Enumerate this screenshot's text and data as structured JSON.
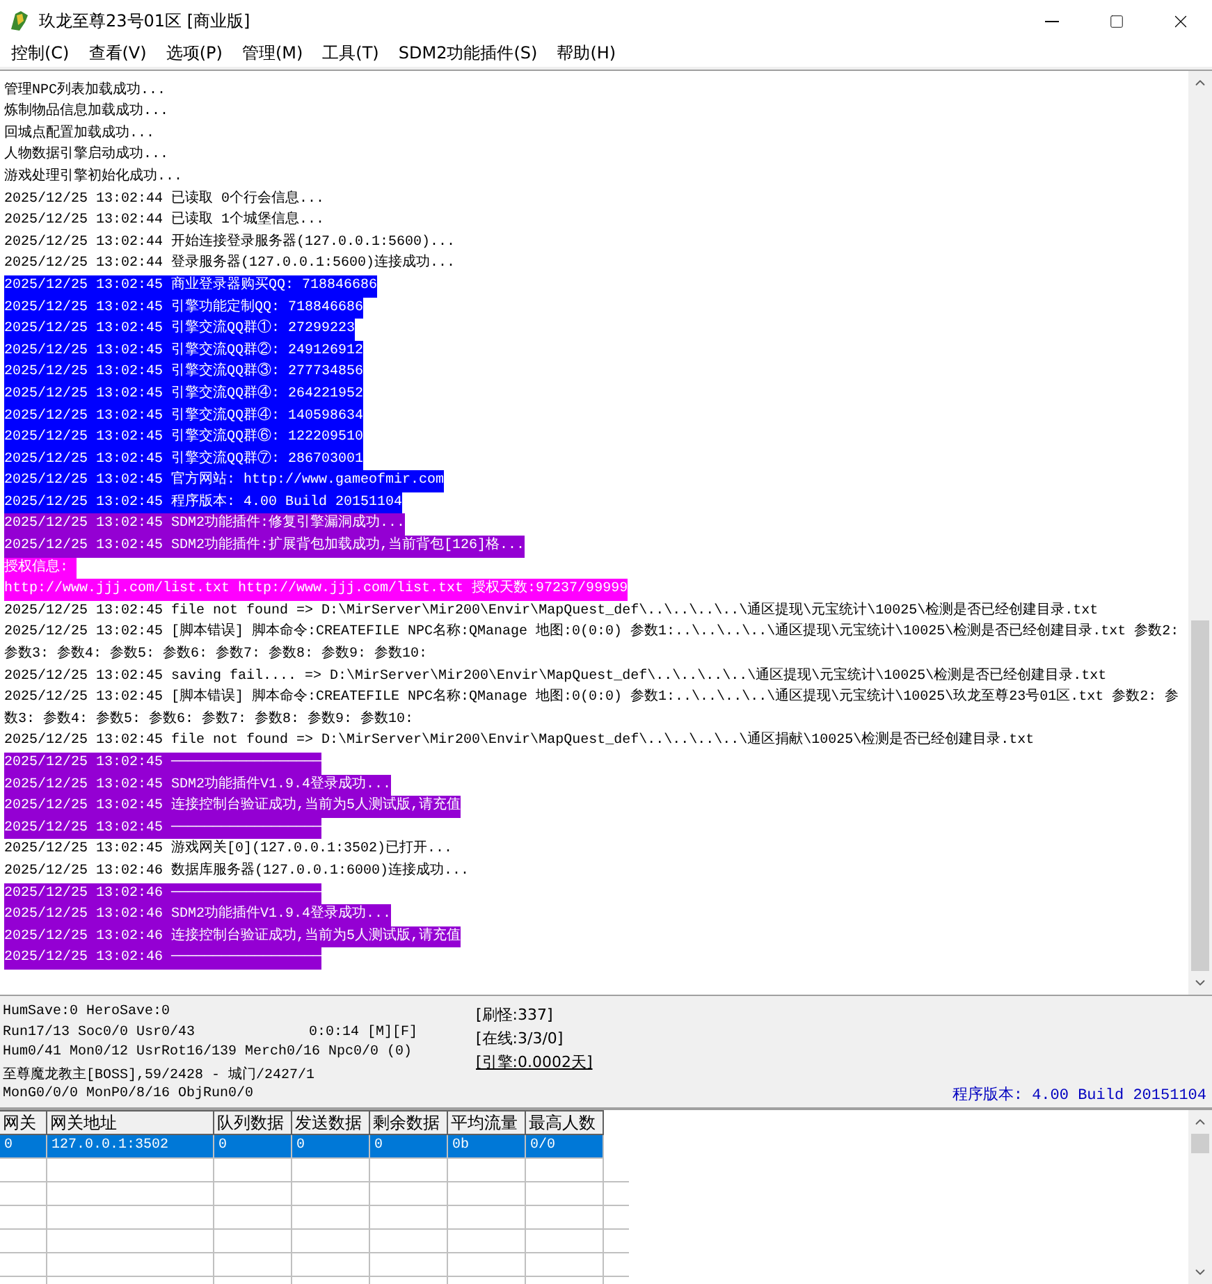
{
  "window": {
    "title": "玖龙至尊23号01区 [商业版]"
  },
  "menu": [
    "控制(C)",
    "查看(V)",
    "选项(P)",
    "管理(M)",
    "工具(T)",
    "SDM2功能插件(S)",
    "帮助(H)"
  ],
  "log": {
    "lines": [
      {
        "text": "管理NPC列表加载成功..."
      },
      {
        "text": "炼制物品信息加载成功..."
      },
      {
        "text": "回城点配置加载成功..."
      },
      {
        "text": "人物数据引擎启动成功..."
      },
      {
        "text": "游戏处理引擎初始化成功..."
      },
      {
        "text": "2025/12/25 13:02:44 已读取 0个行会信息..."
      },
      {
        "text": "2025/12/25 13:02:44 已读取 1个城堡信息..."
      },
      {
        "text": "2025/12/25 13:02:44 开始连接登录服务器(127.0.0.1:5600)..."
      },
      {
        "text": "2025/12/25 13:02:44 登录服务器(127.0.0.1:5600)连接成功..."
      },
      {
        "text": "2025/12/25 13:02:45 商业登录器购买QQ: 718846686",
        "color": "#0000ff"
      },
      {
        "text": "2025/12/25 13:02:45 引擎功能定制QQ: 718846686",
        "color": "#0000ff"
      },
      {
        "text": "2025/12/25 13:02:45 引擎交流QQ群①: 27299223",
        "color": "#0000ff"
      },
      {
        "text": "2025/12/25 13:02:45 引擎交流QQ群②: 249126912",
        "color": "#0000ff"
      },
      {
        "text": "2025/12/25 13:02:45 引擎交流QQ群③: 277734856",
        "color": "#0000ff"
      },
      {
        "text": "2025/12/25 13:02:45 引擎交流QQ群④: 264221952",
        "color": "#0000ff"
      },
      {
        "text": "2025/12/25 13:02:45 引擎交流QQ群④: 140598634",
        "color": "#0000ff"
      },
      {
        "text": "2025/12/25 13:02:45 引擎交流QQ群⑥: 122209510",
        "color": "#0000ff"
      },
      {
        "text": "2025/12/25 13:02:45 引擎交流QQ群⑦: 286703001",
        "color": "#0000ff"
      },
      {
        "text": "2025/12/25 13:02:45 官方网站: http://www.gameofmir.com",
        "color": "#0000ff"
      },
      {
        "text": "2025/12/25 13:02:45 程序版本: 4.00 Build 20151104",
        "color": "#0000ff"
      },
      {
        "text": "2025/12/25 13:02:45 SDM2功能插件:修复引擎漏洞成功...",
        "color": "#9400d3"
      },
      {
        "text": "2025/12/25 13:02:45 SDM2功能插件:扩展背包加载成功,当前背包[126]格...",
        "color": "#9400d3"
      },
      {
        "text": "授权信息: ",
        "color": "#ff00ff"
      },
      {
        "text": "http://www.jjj.com/list.txt http://www.jjj.com/list.txt 授权天数:97237/99999",
        "color": "#ff00ff"
      },
      {
        "text": "2025/12/25 13:02:45 file not found => D:\\MirServer\\Mir200\\Envir\\MapQuest_def\\..\\..\\..\\..\\通区提现\\元宝统计\\10025\\检测是否已经创建目录.txt"
      },
      {
        "text": "2025/12/25 13:02:45 [脚本错误] 脚本命令:CREATEFILE NPC名称:QManage 地图:0(0:0) 参数1:..\\..\\..\\..\\通区提现\\元宝统计\\10025\\检测是否已经创建目录.txt 参数2: 参数3: 参数4: 参数5: 参数6: 参数7: 参数8: 参数9: 参数10:"
      },
      {
        "text": "2025/12/25 13:02:45 saving fail.... => D:\\MirServer\\Mir200\\Envir\\MapQuest_def\\..\\..\\..\\..\\通区提现\\元宝统计\\10025\\检测是否已经创建目录.txt"
      },
      {
        "text": "2025/12/25 13:02:45 [脚本错误] 脚本命令:CREATEFILE NPC名称:QManage 地图:0(0:0) 参数1:..\\..\\..\\..\\通区提现\\元宝统计\\10025\\玖龙至尊23号01区.txt 参数2: 参数3: 参数4: 参数5: 参数6: 参数7: 参数8: 参数9: 参数10:"
      },
      {
        "text": "2025/12/25 13:02:45 file not found => D:\\MirServer\\Mir200\\Envir\\MapQuest_def\\..\\..\\..\\..\\通区捐献\\10025\\检测是否已经创建目录.txt"
      },
      {
        "text": "2025/12/25 13:02:45 ──────────────────",
        "color": "#9400d3"
      },
      {
        "text": "2025/12/25 13:02:45 SDM2功能插件V1.9.4登录成功...",
        "color": "#9400d3"
      },
      {
        "text": "2025/12/25 13:02:45 连接控制台验证成功,当前为5人测试版,请充值",
        "color": "#9400d3"
      },
      {
        "text": "2025/12/25 13:02:45 ──────────────────",
        "color": "#9400d3"
      },
      {
        "text": "2025/12/25 13:02:45 游戏网关[0](127.0.0.1:3502)已打开..."
      },
      {
        "text": "2025/12/25 13:02:46 数据库服务器(127.0.0.1:6000)连接成功..."
      },
      {
        "text": "2025/12/25 13:02:46 ──────────────────",
        "color": "#9400d3"
      },
      {
        "text": "2025/12/25 13:02:46 SDM2功能插件V1.9.4登录成功...",
        "color": "#9400d3"
      },
      {
        "text": "2025/12/25 13:02:46 连接控制台验证成功,当前为5人测试版,请充值",
        "color": "#9400d3"
      },
      {
        "text": "2025/12/25 13:02:46 ──────────────────",
        "color": "#9400d3"
      }
    ]
  },
  "status": {
    "lines": [
      {
        "text": "HumSave:0 HeroSave:0"
      },
      {
        "text": "Run17/13 Soc0/0 Usr0/43",
        "aside": "0:0:14 [M][F]"
      },
      {
        "text": "Hum0/41 Mon0/12 UsrRot16/139 Merch0/16 Npc0/0 (0)"
      },
      {
        "text": "至尊魔龙教主[BOSS],59/2428 - 城门/2427/1"
      },
      {
        "text": "MonG0/0/0 MonP0/8/16 ObjRun0/0"
      }
    ],
    "counters": [
      {
        "text": "[刷怪:337]",
        "underlined": false
      },
      {
        "text": "[在线:3/3/0]",
        "underlined": false
      },
      {
        "text": "[引擎:0.0002天]",
        "underlined": true
      }
    ],
    "version": "程序版本: 4.00 Build 20151104"
  },
  "table": {
    "columns": [
      "网关",
      "网关地址",
      "队列数据",
      "发送数据",
      "剩余数据",
      "平均流量",
      "最高人数"
    ],
    "rows": [
      {
        "cells": [
          "0",
          "127.0.0.1:3502",
          "0",
          "0",
          "0",
          "0b",
          "0/0"
        ],
        "selected": true
      }
    ]
  }
}
